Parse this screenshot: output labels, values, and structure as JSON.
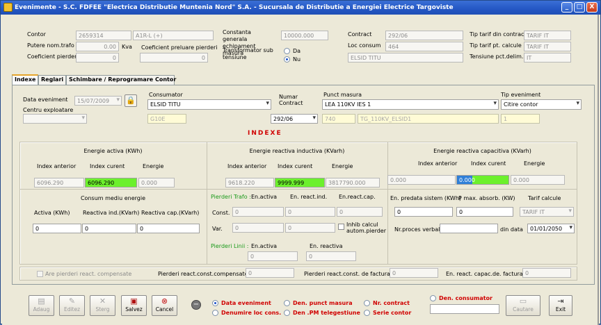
{
  "window": {
    "title": "Evenimente - S.C. FDFEE \"Electrica Distributie Muntenia Nord\" S.A. - Sucursala de Distributie a Energiei Electrice Targoviste",
    "min": "_",
    "max": "□",
    "close": "X"
  },
  "header": {
    "contor_label": "Contor",
    "contor_value": "2659314",
    "contor_type": "A1R-L (+)",
    "putere_label": "Putere nom.trafo",
    "putere_value": "0.00",
    "putere_unit": "Kva",
    "coef_pierderi_label": "Coeficient pierderi",
    "coef_pierderi_value": "0",
    "coef_preluare_label": "Coeficient preluare pierderi",
    "coef_preluare_value": "0",
    "constanta_label": "Constanta generala echipament masura",
    "constanta_value": "10000.000",
    "transformator_label": "Transformator sub tensiune",
    "radio_da": "Da",
    "radio_nu": "Nu",
    "contract_label": "Contract",
    "contract_value": "292/06",
    "loc_consum_label": "Loc consum",
    "loc_consum_value": "464",
    "loc_name_value": "ELSID TITU",
    "tip_tarif_label": "Tip tarif din contract",
    "tip_tarif_value": "TARIF IT",
    "tip_tarif_pt_label": "Tip tarif pt. calcule",
    "tip_tarif_pt_value": "TARIF IT",
    "tensiune_label": "Tensiune pct.delim.",
    "tensiune_value": "IT"
  },
  "tabs": [
    "Indexe",
    "Reglari",
    "Schimbare / Reprogramare Contor"
  ],
  "event": {
    "data_label": "Data eveniment",
    "data_value": "15/07/2009",
    "centru_label": "Centru exploatare",
    "centru_value": "",
    "consumator_label": "Consumator",
    "consumator_value": "ELSID TITU",
    "consumator_code": "G10E",
    "nr_contract_label": "Numar Contract",
    "nr_contract_value": "292/06",
    "punct_label": "Punct masura",
    "punct_value": "LEA 110KV IES 1",
    "punct_code": "740",
    "punct_name": "TG_110KV_ELSID1",
    "tip_label": "Tip eveniment",
    "tip_value": "Citire contor",
    "tip_code": "1",
    "indexe_heading": "INDEXE"
  },
  "activa": {
    "title": "Energie activa (KWh)",
    "h1": "Index anterior",
    "h2": "Index curent",
    "h3": "Energie",
    "v1": "6096.290",
    "v2": "6096.290",
    "v3": "0.000"
  },
  "inductiva": {
    "title": "Energie reactiva inductiva (KVarh)",
    "h1": "Index anterior",
    "h2": "Index curent",
    "h3": "Energie",
    "v1": "9618.220",
    "v2": "9999.999",
    "v3": "3817790.000"
  },
  "capacitiva": {
    "title": "Energie reactiva capacitiva (KVarh)",
    "h1": "Index anterior",
    "h2": "Index curent",
    "h3": "Energie",
    "v1": "0.000",
    "v2": "0.000",
    "v3": "0.000"
  },
  "consum_mediu": {
    "title": "Consum mediu energie",
    "h1": "Activa (KWh)",
    "h2": "Reactiva ind.(KVarh)",
    "h3": "Reactiva cap.(KVarh)",
    "v1": "0",
    "v2": "0",
    "v3": "0"
  },
  "pierderi_trafo": {
    "label": "Pierderi Trafo :",
    "h1": "En.activa",
    "h2": "En. react.ind.",
    "h3": "En.react.cap.",
    "const_label": "Const.",
    "var_label": "Var.",
    "c1": "0",
    "c2": "0",
    "c3": "0",
    "v1": "0",
    "v2": "0",
    "v3": "0",
    "inhib_label": "Inhib calcul autom.pierder"
  },
  "pierderi_linii": {
    "label": "Pierderi Linii :",
    "h1": "En.activa",
    "h2": "En. reactiva",
    "v1": "0",
    "v2": "0"
  },
  "right_panel": {
    "en_predata_label": "En. predata sistem (KWh)",
    "pmax_label": "P max. absorb. (KW)",
    "tarif_calc_label": "Tarif calcule",
    "en_predata_value": "0",
    "pmax_value": "0",
    "tarif_calc_value": "TARIF IT",
    "nr_proces_label": "Nr.proces verbal",
    "nr_proces_value": "",
    "din_data_label": "din data",
    "din_data_value": "01/01/2050"
  },
  "bottom_row": {
    "are_pierderi_label": "Are pierderi react. compensate",
    "pierderi_const_label": "Pierderi react.const.compensate",
    "pierderi_const_value": "0",
    "pierderi_fact_label": "Pierderi react.const. de facturat",
    "pierderi_fact_value": "0",
    "en_react_label": "En. react. capac.de. facturat",
    "en_react_value": "0"
  },
  "toolbar": {
    "adaug": "Adaug",
    "editez": "Editez",
    "sterg": "Sterg",
    "salvez": "Salvez",
    "cancel": "Cancel",
    "cautare": "Cautare",
    "exit": "Exit"
  },
  "sort_options": {
    "data_eveniment": "Data eveniment",
    "denumire_loc": "Denumire loc cons.",
    "den_punct": "Den. punct masura",
    "den_pm": "Den .PM telegestiune",
    "nr_contract": "Nr. contract",
    "serie_contor": "Serie contor",
    "den_consumator": "Den. consumator",
    "search_value": ""
  },
  "colors": {
    "title_bar": "#2457c4",
    "highlight_green": "#6cf02c",
    "highlight_blue": "#2f7fd8",
    "indexe_red": "#d00000",
    "pierderi_green": "#1a9a1a"
  }
}
